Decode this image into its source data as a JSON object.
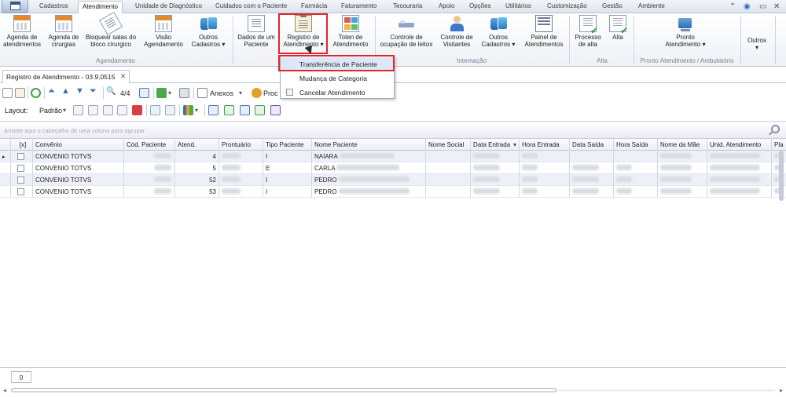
{
  "menubar": {
    "items": [
      "Cadastros",
      "Atendimento",
      "Unidade de Diagnóstico",
      "Cuidados com o Paciente",
      "Farmácia",
      "Faturamento",
      "Tesouraria",
      "Apoio",
      "Opções",
      "Utilitários",
      "Customização",
      "Gestão",
      "Ambiente"
    ],
    "active": "Atendimento",
    "window_controls": [
      "⌃",
      "◉",
      "▭",
      "✕"
    ]
  },
  "ribbon": {
    "buttons": {
      "agenda_atendimentos": "Agenda de\natendimentos",
      "agenda_cirurgias": "Agenda de\ncirurgias",
      "bloquear_salas": "Bloquear salas do\nbloco cirurgico",
      "visao_agendamento": "Visão\nAgendamento",
      "outros_cadastros_1": "Outros\nCadastros ▾",
      "dados_paciente": "Dados de um\nPaciente",
      "registro_atendimento": "Registro de\nAtendimento ▾",
      "toten_atendimento": "Toten de\nAtendimento",
      "controle_ocupacao": "Controle de\nocupação de leitos",
      "controle_visitantes": "Controle de\nVisitantes",
      "outros_cadastros_2": "Outros\nCadastros ▾",
      "painel_atendimentos": "Painel de\nAtendimentos",
      "processo_alta": "Processo\nde alta",
      "alta": "Alta",
      "pronto_atendimento": "Pronto\nAtendimento ▾",
      "outros": "Outros\n▾"
    },
    "groups": {
      "agendamento": "Agendamento",
      "internacao": "Internação",
      "alta": "Alta",
      "pronto": "Pronto Atendimento / Ambulatório"
    }
  },
  "dropdown": {
    "items": [
      "Transferência de Paciente",
      "Mudança de Categoria",
      "Cancelar Atendimento"
    ],
    "highlighted": "Transferência de Paciente"
  },
  "doc_tab": {
    "title": "Registro de Atendimento - 03.9.0515",
    "close": "✕"
  },
  "toolbar1": {
    "record_counter": "4/4",
    "anexos": "Anexos",
    "proc": "Proc"
  },
  "toolbar2": {
    "layout_label": "Layout:",
    "layout_value": "Padrão"
  },
  "group_panel": {
    "hint": "Arraste aqui o cabeçalho de uma coluna para agrupar"
  },
  "grid": {
    "columns": [
      "[x]",
      "Convênio",
      "Cód. Paciente",
      "Atend.",
      "Prontuário",
      "Tipo Paciente",
      "Nome Paciente",
      "Nome Social",
      "Data Entrada",
      "Hora Entrada",
      "Data Saída",
      "Hora Saída",
      "Nome da Mãe",
      "Unid. Atendimento",
      "Pla"
    ],
    "rows": [
      {
        "convenio": "CONVENIO TOTVS",
        "atend": "4",
        "tipo": "I",
        "nome": "NAIARA"
      },
      {
        "convenio": "CONVENIO TOTVS",
        "atend": "5",
        "tipo": "E",
        "nome": "CARLA"
      },
      {
        "convenio": "CONVENIO TOTVS",
        "atend": "52",
        "tipo": "I",
        "nome": "PEDRO"
      },
      {
        "convenio": "CONVENIO TOTVS",
        "atend": "53",
        "tipo": "I",
        "nome": "PEDRO"
      }
    ]
  },
  "footer": {
    "count": "0"
  },
  "colors": {
    "highlight_red": "#e0262c",
    "menu_selected": "#dce8f7"
  }
}
